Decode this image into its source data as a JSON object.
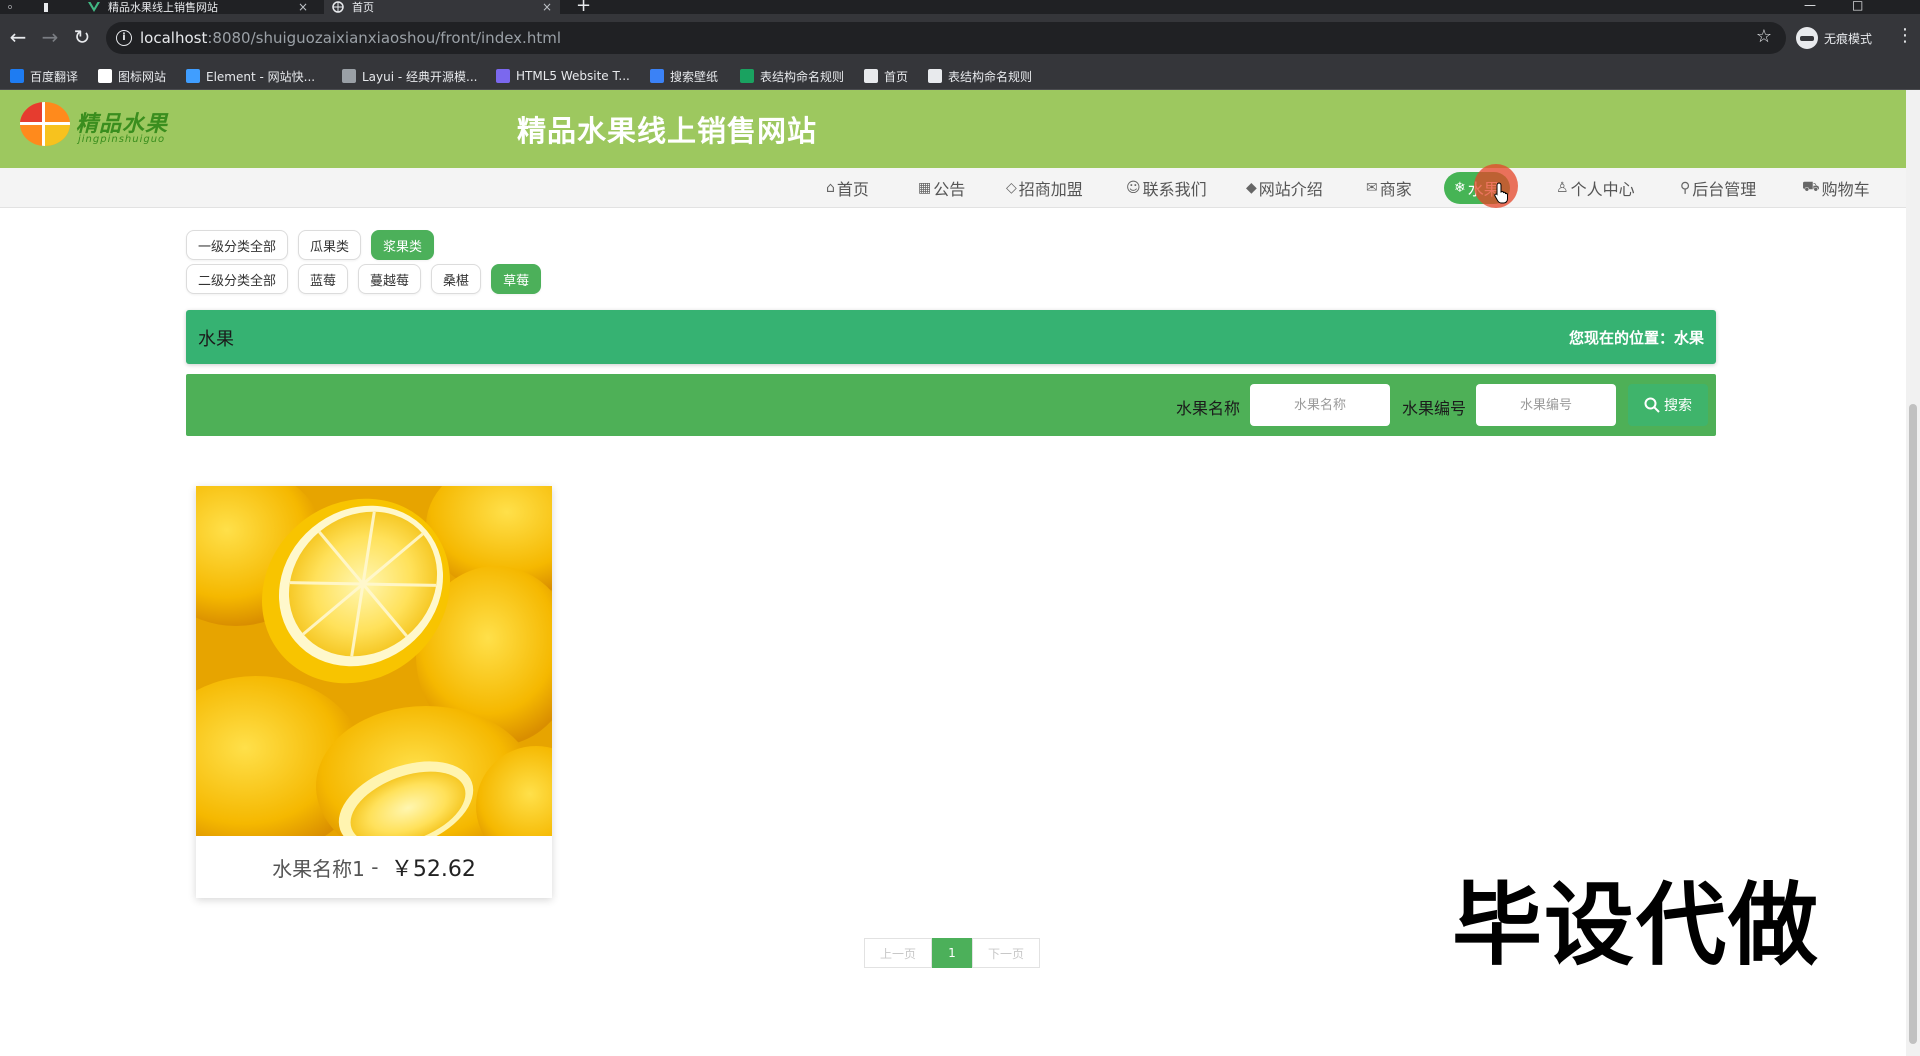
{
  "browser": {
    "tabs": [
      {
        "title": "精品水果线上销售网站",
        "active": false
      },
      {
        "title": "首页",
        "active": true
      }
    ],
    "new_tab": "+",
    "url_host": "localhost",
    "url_path": ":8080/shuiguozaixianxiaoshou/front/index.html",
    "incognito_label": "无痕模式",
    "bookmarks": [
      {
        "label": "百度翻译",
        "icon_color": "#1e7cf2"
      },
      {
        "label": "图标网站",
        "icon_color": "#ffffff"
      },
      {
        "label": "Element - 网站快...",
        "icon_color": "#409eff"
      },
      {
        "label": "Layui - 经典开源模...",
        "icon_color": "#9aa0a6"
      },
      {
        "label": "HTML5 Website T...",
        "icon_color": "#7b68ee"
      },
      {
        "label": "搜索壁纸",
        "icon_color": "#3b82f6"
      },
      {
        "label": "表结构命名规则",
        "icon_color": "#1aa260"
      },
      {
        "label": "首页",
        "icon_color": "#e8eaed"
      },
      {
        "label": "表结构命名规则",
        "icon_color": "#e8eaed"
      }
    ]
  },
  "header": {
    "logo_text": "精品水果",
    "logo_sub": "jingpinshuiguo",
    "site_title": "精品水果线上销售网站"
  },
  "nav": {
    "items": [
      {
        "icon": "⌂",
        "icon_name": "home-icon",
        "label": "首页"
      },
      {
        "icon": "▦",
        "icon_name": "notice-icon",
        "label": "公告"
      },
      {
        "icon": "◇",
        "icon_name": "tag-icon",
        "label": "招商加盟"
      },
      {
        "icon": "☺",
        "icon_name": "contact-icon",
        "label": "联系我们"
      },
      {
        "icon": "◆",
        "icon_name": "layers-icon",
        "label": "网站介绍"
      },
      {
        "icon": "✉",
        "icon_name": "mail-icon",
        "label": "商家"
      },
      {
        "icon": "❄",
        "icon_name": "snowflake-icon",
        "label": "水果"
      },
      {
        "icon": "♙",
        "icon_name": "user-icon",
        "label": "个人中心"
      },
      {
        "icon": "⚲",
        "icon_name": "link-icon",
        "label": "后台管理"
      },
      {
        "icon": "⛟",
        "icon_name": "cart-icon",
        "label": "购物车"
      }
    ],
    "active_index": 6
  },
  "filters": {
    "level1": [
      "一级分类全部",
      "瓜果类",
      "浆果类"
    ],
    "level1_active": 2,
    "level2": [
      "二级分类全部",
      "蓝莓",
      "蔓越莓",
      "桑椹",
      "草莓"
    ],
    "level2_active": 4
  },
  "section": {
    "title": "水果",
    "location": "您现在的位置：水果"
  },
  "search": {
    "name_label": "水果名称",
    "name_placeholder": "水果名称",
    "code_label": "水果编号",
    "code_placeholder": "水果编号",
    "button_label": "搜索"
  },
  "products": [
    {
      "name": "水果名称1",
      "separator": " - ",
      "price": "￥52.62"
    }
  ],
  "pagination": {
    "prev": "上一页",
    "current": "1",
    "next": "下一页"
  },
  "watermark": "毕设代做",
  "colors": {
    "header_bg": "#9dc85f",
    "accent_green": "#4cb05a",
    "title_bar": "#36b272"
  }
}
